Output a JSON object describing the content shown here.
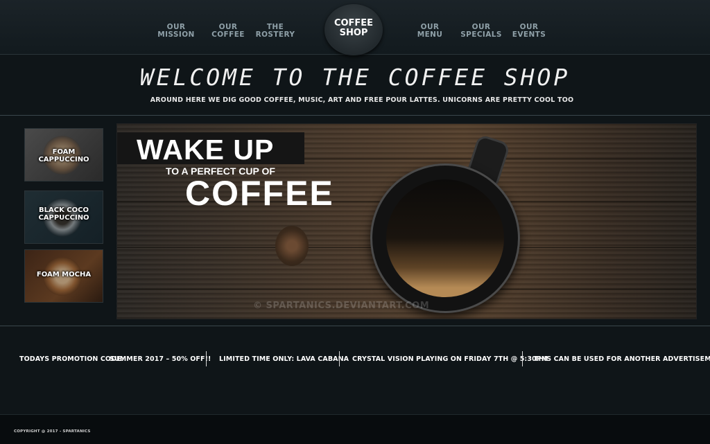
{
  "nav": {
    "left": [
      {
        "line1": "OUR",
        "line2": "MISSION"
      },
      {
        "line1": "OUR",
        "line2": "COFFEE"
      },
      {
        "line1": "THE",
        "line2": "ROSTERY"
      }
    ],
    "right": [
      {
        "line1": "OUR",
        "line2": "MENU"
      },
      {
        "line1": "OUR",
        "line2": "SPECIALS"
      },
      {
        "line1": "OUR",
        "line2": "EVENTS"
      }
    ]
  },
  "logo": {
    "line1": "COFFEE",
    "line2": "SHOP"
  },
  "header": {
    "title": "WELCOME TO THE COFFEE SHOP",
    "tagline": "AROUND HERE WE DIG GOOD COFFEE, MUSIC, ART AND FREE POUR LATTES. UNICORNS ARE PRETTY COOL TOO"
  },
  "sidebar": {
    "items": [
      {
        "line1": "FOAM",
        "line2": "CAPPUCCINO"
      },
      {
        "line1": "BLACK COCO",
        "line2": "CAPPUCCINO"
      },
      {
        "line1": "FOAM MOCHA",
        "line2": ""
      }
    ]
  },
  "hero": {
    "headline": "WAKE UP",
    "subline": "TO A PERFECT CUP OF",
    "big": "COFFEE",
    "watermark": "© SPARTANICS.DEVIANTART.COM"
  },
  "promo_bar": {
    "label": "TODAYS PROMOTION CODE:",
    "code": "SUMMER 2017 – 50% OFF!!",
    "item2": "LIMITED TIME ONLY: LAVA CABANA",
    "item3": "CRYSTAL VISION PLAYING ON FRIDAY 7TH @ 5:30PM",
    "item4": "THIS CAN BE USED FOR ANOTHER ADVERTISEMENT"
  },
  "footer": {
    "copyright": "COPYRIGHT @ 2017 - SPARTANICS"
  },
  "colors": {
    "background": "#0f1518",
    "nav_text": "#8fa0a8",
    "text": "#ffffff"
  }
}
